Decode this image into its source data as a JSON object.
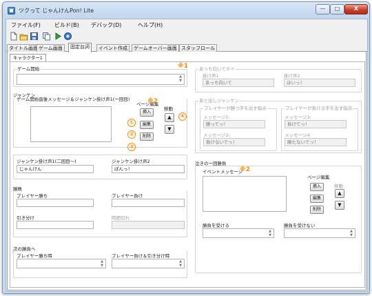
{
  "window": {
    "title": "ツクって じゃんけんPon! Lite",
    "min": "—",
    "max": "□",
    "close": "X"
  },
  "menu": [
    "ファイル(F)",
    "ビルド(B)",
    "デバック(D)",
    "ヘルプ(H)"
  ],
  "toolbar": [
    "new-file-icon",
    "open-folder-icon",
    "save-icon",
    "copy-icon",
    "play-icon",
    "debug-icon"
  ],
  "tabs": [
    "タイトル画面",
    "ゲーム画面",
    "固定台詞",
    "イベント作成",
    "ゲームオーバー画面",
    "スタッフロール"
  ],
  "subtab": "キャラクター1",
  "annotations": {
    "note1": "※1",
    "note2a": "※2",
    "note2b": "※2",
    "n1": "①",
    "n2": "②",
    "n3": "③",
    "n4": "④"
  },
  "left": {
    "game_start": {
      "title": "ゲーム開始",
      "value": ""
    },
    "janken": {
      "title": "ジャンケン",
      "intro_label": "ゲーム開始直後メッセージ＆ジャンケン掛け声1(一回目)",
      "page_edit": "ページ編集",
      "move": "移動",
      "insert": "挿入",
      "edit": "編集",
      "delete": "削除",
      "up": "▲",
      "down": "▼",
      "call1_label": "ジャンケン掛け声1(二回目〜)",
      "call1_value": "じゃんけん",
      "call2_label": "ジャンケン掛け声2",
      "call2_value": "ぽんっ！"
    },
    "result": {
      "title": "勝敗",
      "player_win": "プレイヤー勝ち",
      "player_lose": "プレイヤー負け",
      "draw": "引き分け",
      "timeout": "時間切れ"
    },
    "next": {
      "title": "次の勝負へ",
      "on_win": "プレイヤー勝ち時",
      "on_lose_draw": "プレイヤー負け＆引き分け時"
    }
  },
  "right": {
    "acchi": {
      "title": "あっち向いてホイ",
      "call1_label": "掛け声1",
      "call1_value": "あっち向いて",
      "call2_label": "掛け声2",
      "call2_value": "ほいっ！"
    },
    "atodashi": {
      "title": "あと出しジャンケン",
      "win_title": "プレイヤーが勝つ手を出す指示",
      "lose_title": "プレイヤーが負ける手を出す指示",
      "msg1_label": "メッセージ1:",
      "msg1_value": "勝ってっ！",
      "msg2_label": "メッセージ2:",
      "msg2_value": "負けないでっ！",
      "msg3_label": "メッセージ3:",
      "msg3_value": "負けてっ！",
      "msg4_label": "メッセージ4:",
      "msg4_value": "勝たないでっ！"
    },
    "cry": {
      "title": "泣きの一回勝負",
      "event_label": "イベントメッセージ",
      "page_edit": "ページ編集",
      "move": "移動",
      "insert": "挿入",
      "edit": "編集",
      "delete": "削除",
      "up": "▲",
      "down": "▼",
      "accept": "勝負を受ける",
      "decline": "勝負を受けない"
    }
  }
}
